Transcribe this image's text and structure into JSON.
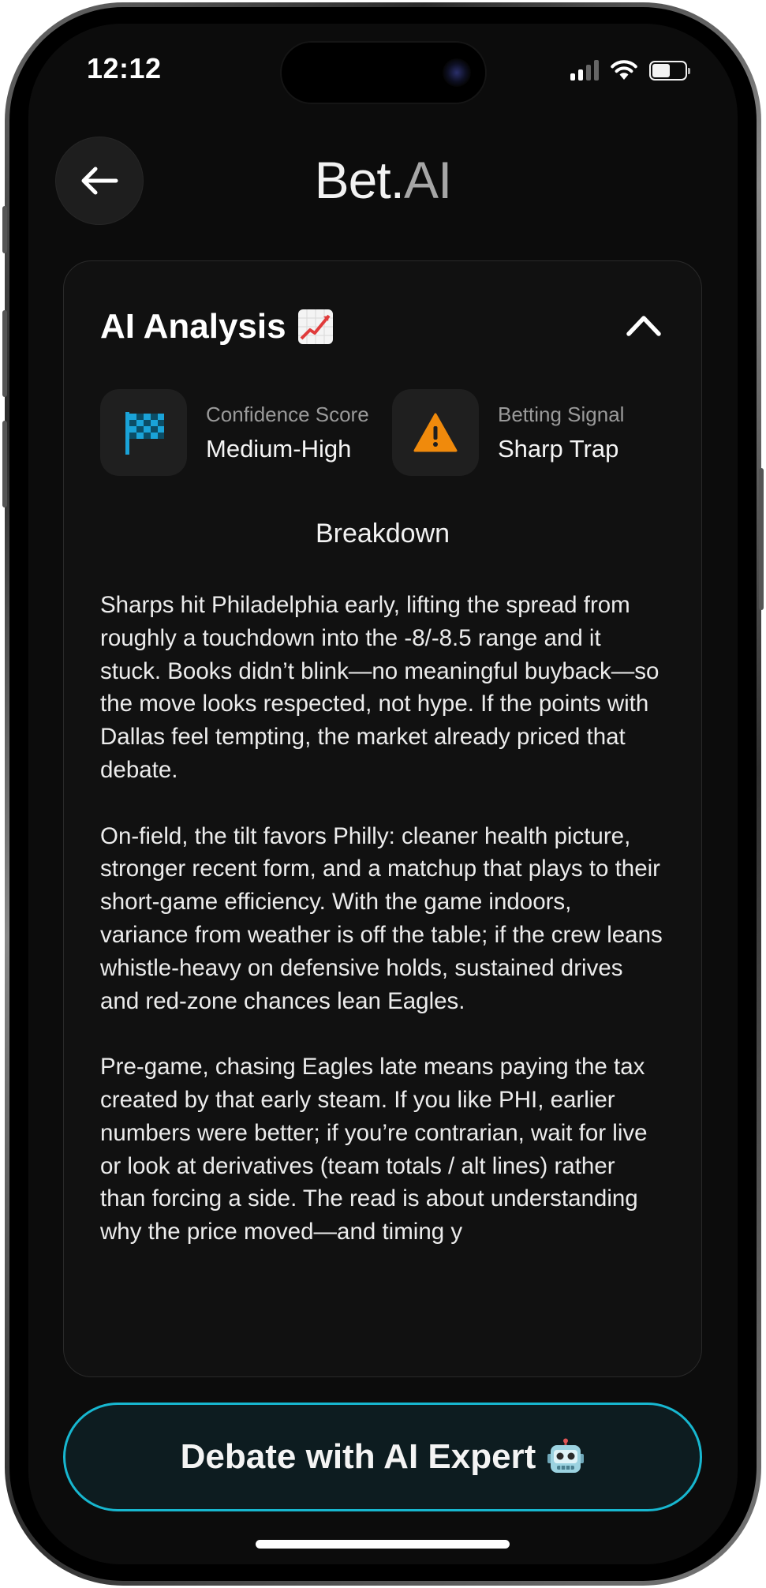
{
  "status_bar": {
    "time": "12:12"
  },
  "header": {
    "title_main": "Bet.",
    "title_accent": "AI",
    "back_icon": "arrow-left-icon"
  },
  "analysis_card": {
    "title": "AI Analysis",
    "title_icon": "chart-increasing-icon",
    "collapse_icon": "chevron-up-icon",
    "confidence": {
      "label": "Confidence Score",
      "value": "Medium-High",
      "icon": "checkered-flag-icon",
      "icon_color": "#1aa3d8"
    },
    "signal": {
      "label": "Betting Signal",
      "value": "Sharp Trap",
      "icon": "warning-icon",
      "icon_color": "#f08a0c"
    },
    "breakdown_title": "Breakdown",
    "paragraphs": [
      "Sharps hit Philadelphia early, lifting the spread from roughly a touchdown into the -8/-8.5 range and it stuck. Books didn’t blink—no meaningful buyback—so the move looks respected, not hype. If the points with Dallas feel tempting, the market already priced that debate.",
      "On-field, the tilt favors Philly: cleaner health picture, stronger recent form, and a matchup that plays to their short-game efficiency. With the game indoors, variance from weather is off the table; if the crew leans whistle-heavy on defensive holds, sustained drives and red-zone chances lean Eagles.",
      "Pre-game, chasing Eagles late means paying the tax created by that early steam. If you like PHI, earlier numbers were better; if you’re contrarian, wait for live or look at derivatives (team totals / alt lines) rather than forcing a side. The read is about understanding why the price moved—and timing y"
    ]
  },
  "cta": {
    "label": "Debate with AI Expert",
    "icon": "robot-icon",
    "border_color": "#17b7d0"
  }
}
